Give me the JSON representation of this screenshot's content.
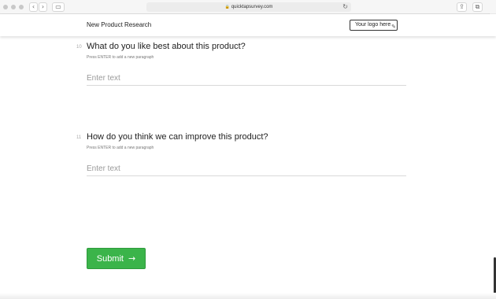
{
  "browser": {
    "url": "quicktapsurvey.com",
    "icons": [
      "back-icon",
      "forward-icon",
      "sidebar-icon",
      "lock-icon",
      "reload-icon",
      "share-icon",
      "tabs-icon",
      "new-tab-icon"
    ]
  },
  "header": {
    "title": "New Product Research",
    "logo_label": "Your logo here"
  },
  "questions": [
    {
      "number": "10",
      "text": "What do you like best about this product?",
      "hint": "Press ENTER to add a new paragraph",
      "placeholder": "Enter text",
      "value": ""
    },
    {
      "number": "11",
      "text": "How do you think we can improve this product?",
      "hint": "Press ENTER to add a new paragraph",
      "placeholder": "Enter text",
      "value": ""
    }
  ],
  "submit": {
    "label": "Submit",
    "arrow": "→",
    "color": "#3bb44a"
  }
}
